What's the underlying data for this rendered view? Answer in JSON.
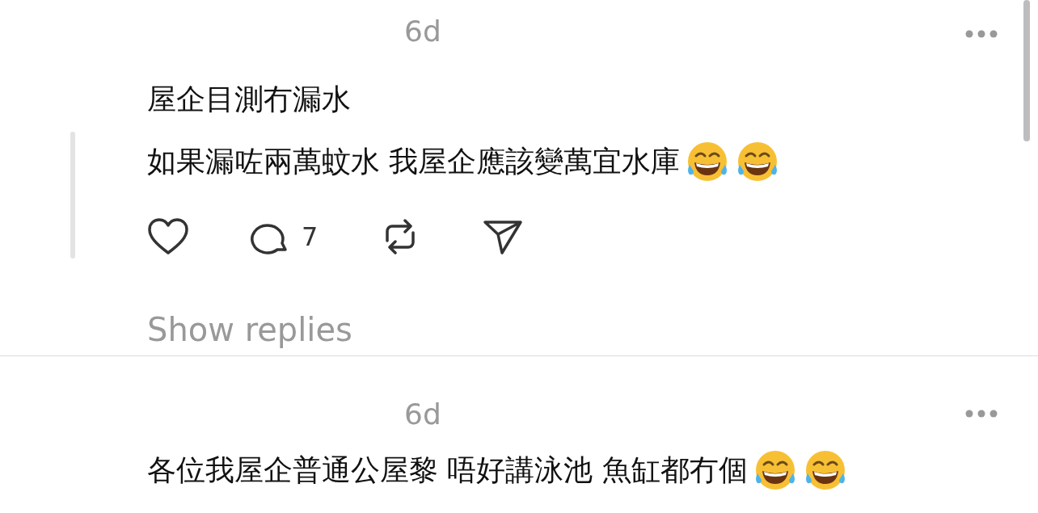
{
  "posts": [
    {
      "time": "6d",
      "lines": [
        "屋企目測冇漏水",
        "如果漏咗兩萬蚊水 我屋企應該變萬宜水庫"
      ],
      "emojis": [
        {
          "kind": "laughing"
        },
        {
          "kind": "laughing"
        }
      ],
      "thread_line": true,
      "actions": {
        "reply_count": "7"
      },
      "show_replies": "Show replies"
    },
    {
      "time": "6d",
      "lines": [
        "各位我屋企普通公屋黎 唔好講泳池 魚缸都冇個"
      ],
      "emojis": [
        {
          "kind": "laughing"
        },
        {
          "kind": "laughing"
        }
      ],
      "thread_line": false
    }
  ]
}
